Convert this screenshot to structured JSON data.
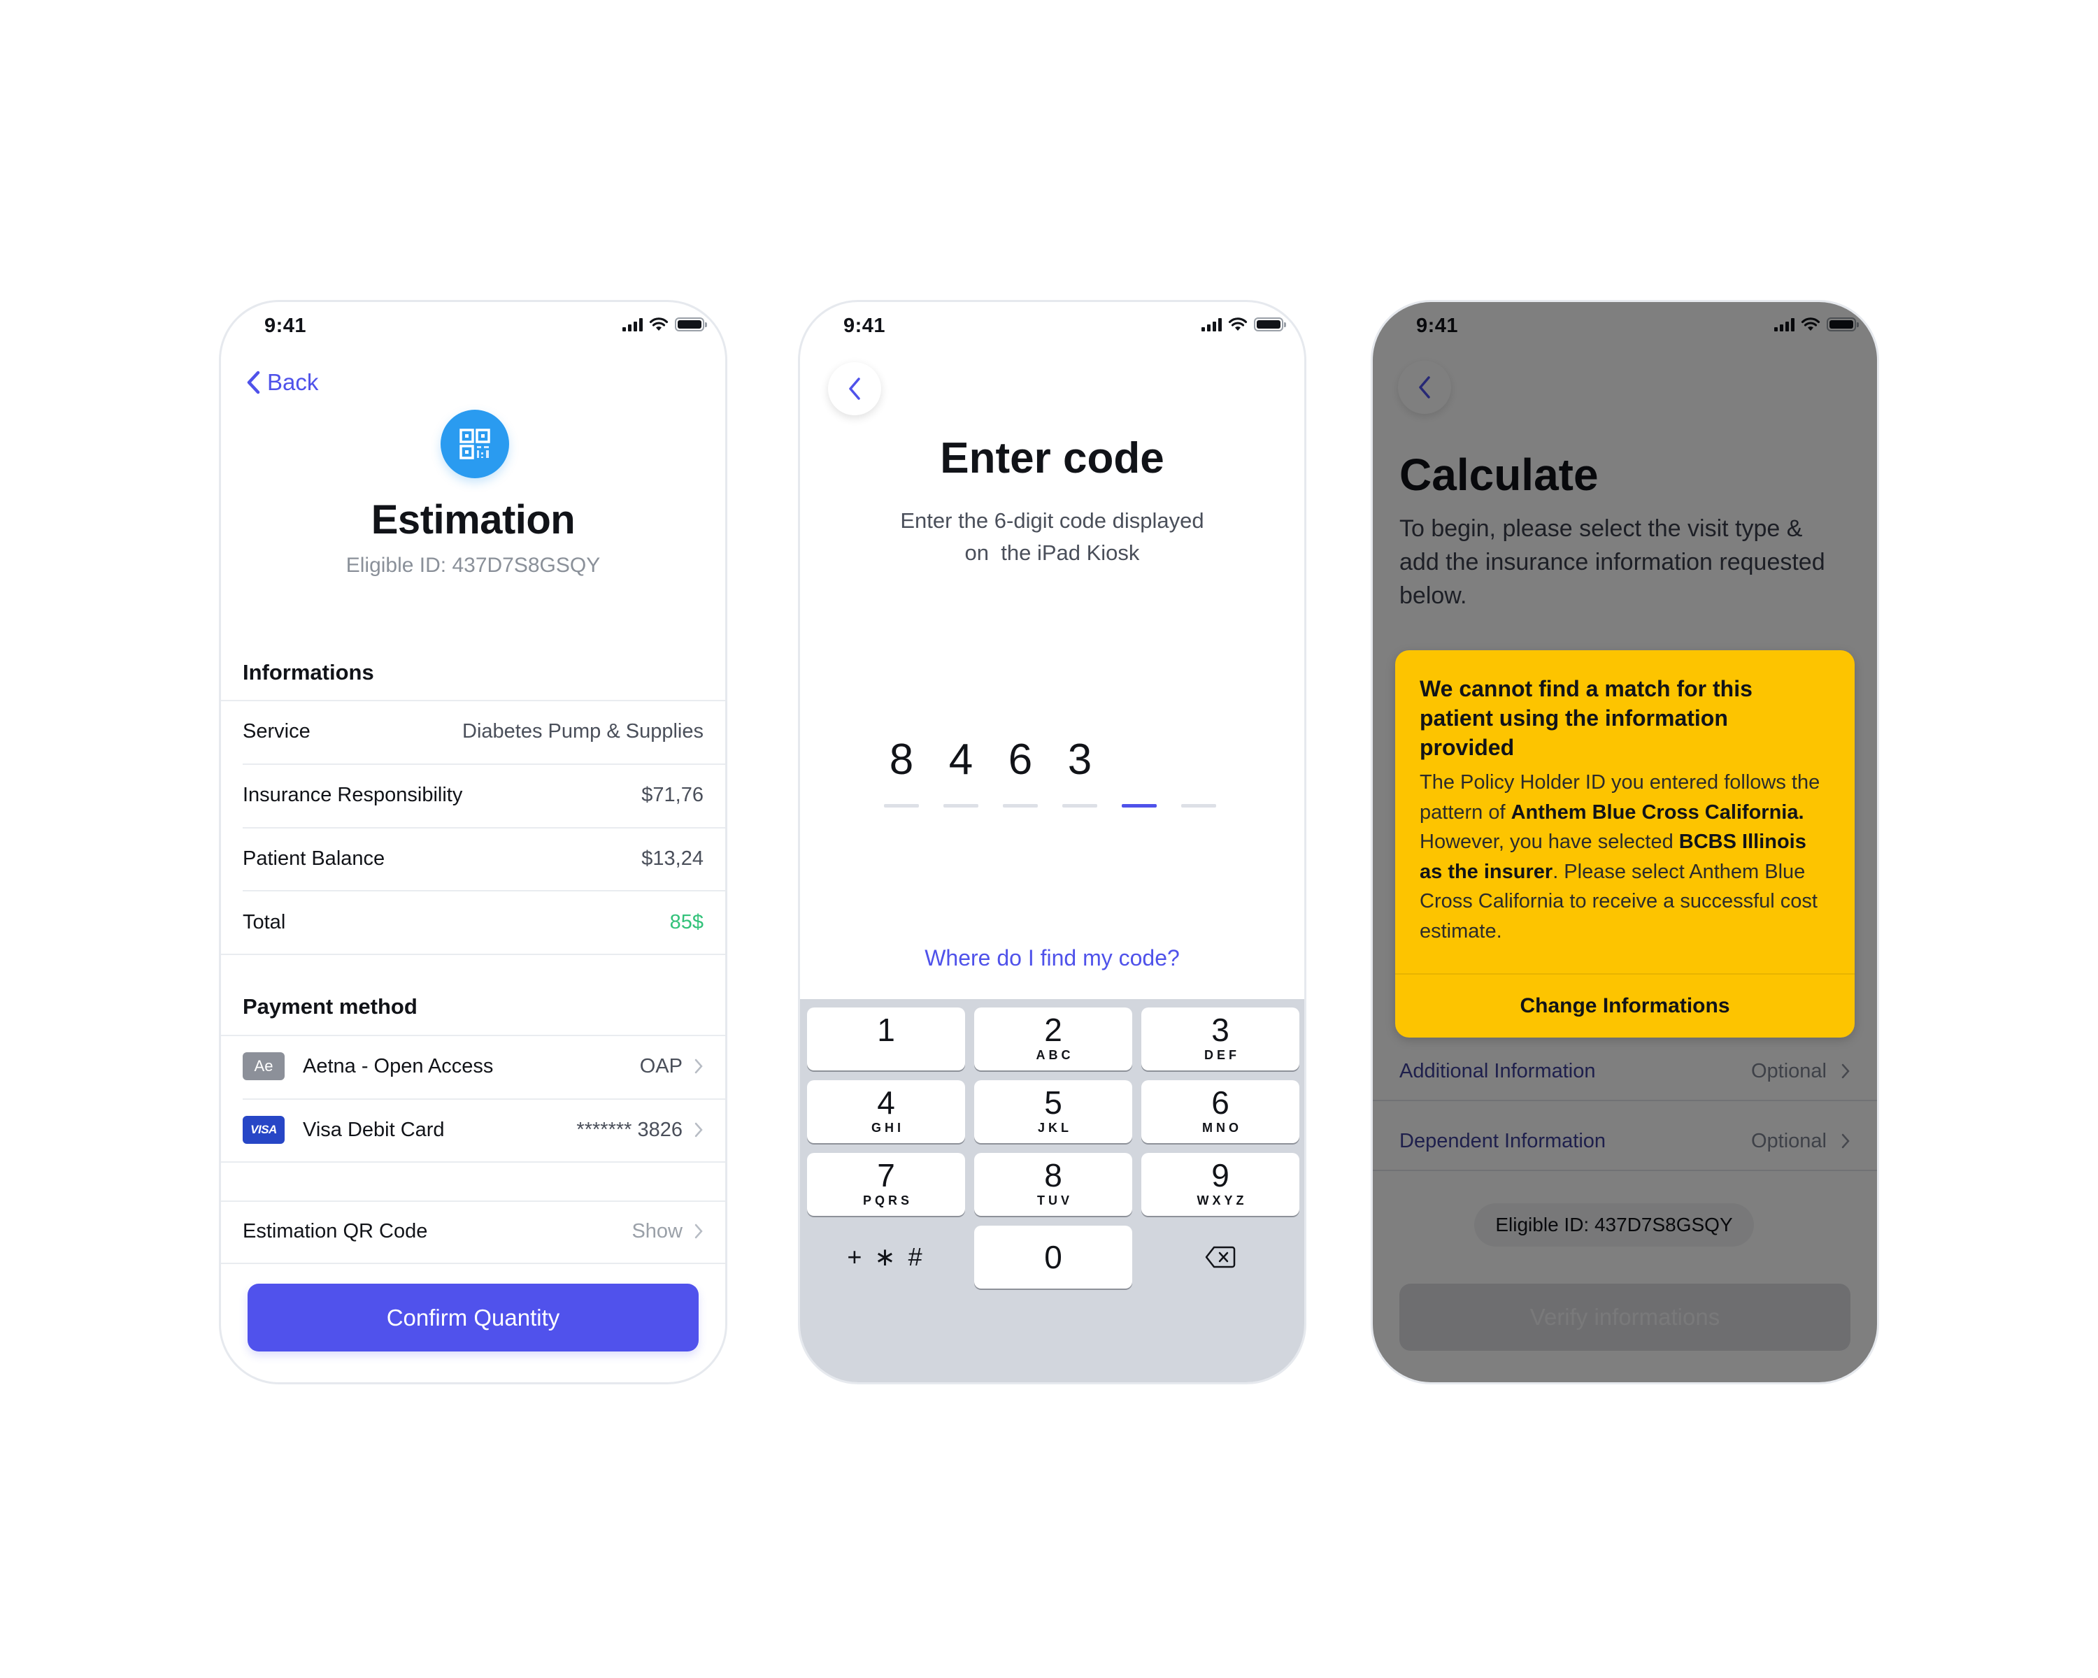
{
  "status_bar": {
    "time": "9:41"
  },
  "estimation_screen": {
    "back_label": "Back",
    "icon": "qr-code-icon",
    "title": "Estimation",
    "eligible_id": "Eligible ID: 437D7S8GSQY",
    "informations": {
      "heading": "Informations",
      "rows": [
        {
          "label": "Service",
          "value": "Diabetes Pump & Supplies"
        },
        {
          "label": "Insurance Responsibility",
          "value": "$71,76"
        },
        {
          "label": "Patient Balance",
          "value": "$13,24"
        },
        {
          "label": "Total",
          "value": "85$"
        }
      ]
    },
    "payment": {
      "heading": "Payment method",
      "methods": [
        {
          "badge": "Ae",
          "label": "Aetna - Open Access",
          "value": "OAP"
        },
        {
          "badge": "VISA",
          "label": "Visa Debit Card",
          "value": "******* 3826"
        }
      ]
    },
    "qr_row": {
      "label": "Estimation QR Code",
      "value": "Show"
    },
    "confirm_button": "Confirm Quantity",
    "colors": {
      "accent": "#5052ec",
      "total": "#33c27a",
      "qr_badge": "#2a9bf0"
    }
  },
  "code_screen": {
    "title": "Enter code",
    "subtitle_line1": "Enter the 6-digit code displayed",
    "subtitle_line2": "on  the iPad Kiosk",
    "code_digits": [
      "8",
      "4",
      "6",
      "3",
      "",
      ""
    ],
    "active_index": 4,
    "help_link": "Where do I find my code?",
    "keypad": [
      {
        "num": "1",
        "letters": ""
      },
      {
        "num": "2",
        "letters": "ABC"
      },
      {
        "num": "3",
        "letters": "DEF"
      },
      {
        "num": "4",
        "letters": "GHI"
      },
      {
        "num": "5",
        "letters": "JKL"
      },
      {
        "num": "6",
        "letters": "MNO"
      },
      {
        "num": "7",
        "letters": "PQRS"
      },
      {
        "num": "8",
        "letters": "TUV"
      },
      {
        "num": "9",
        "letters": "WXYZ"
      }
    ],
    "symbols_key": "+ ∗ #",
    "zero_key": "0",
    "delete_key_icon": "backspace-icon"
  },
  "calculate_screen": {
    "title": "Calculate",
    "description": "To begin, please select the visit type & add the insurance information requested below.",
    "rows": [
      {
        "label": "Additional Information",
        "value": "Optional"
      },
      {
        "label": "Dependent Information",
        "value": "Optional"
      }
    ],
    "eligible_id": "Eligible ID: 437D7S8GSQY",
    "verify_button": "Verify informations",
    "alert": {
      "title": "We cannot find a match for this patient using the information provided",
      "body_1": "The Policy Holder ID you entered follows the pattern of ",
      "body_bold_1": "Anthem Blue Cross California.",
      "body_2": " However, you have selected ",
      "body_bold_2": "BCBS Illinois as the insurer",
      "body_3": ". Please select Anthem Blue Cross California to receive a successful cost estimate.",
      "button": "Change Informations",
      "color": "#fdc400"
    }
  }
}
